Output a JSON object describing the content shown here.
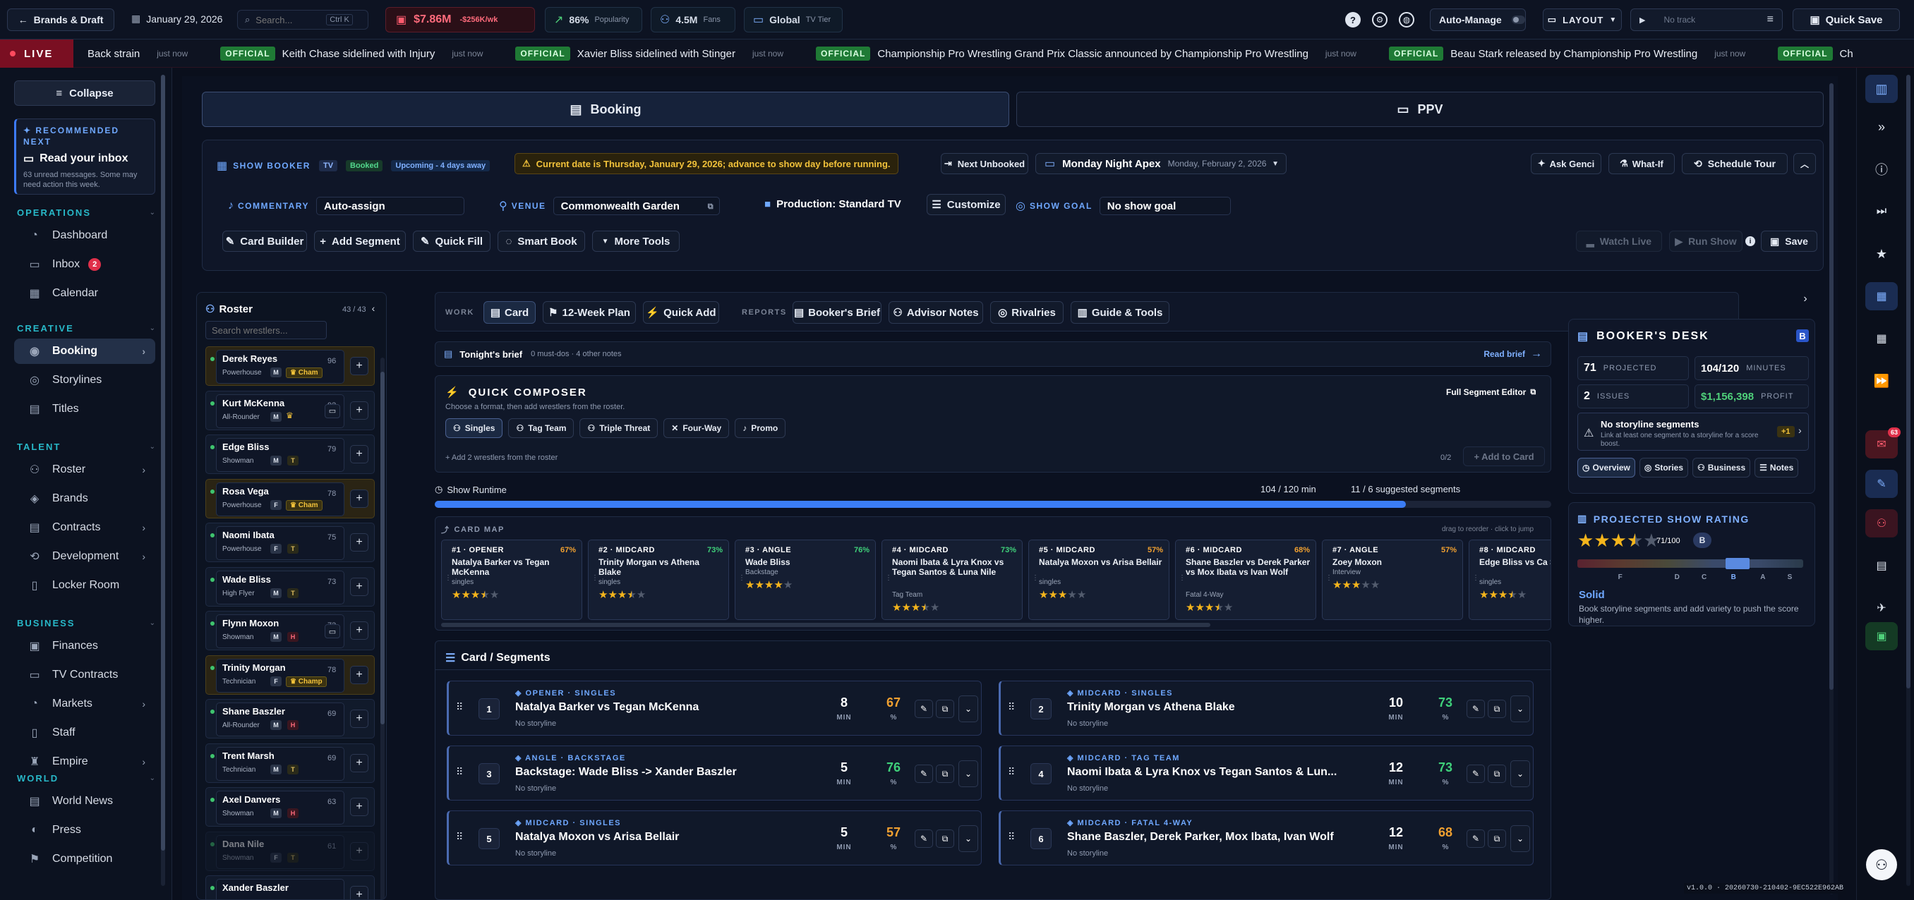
{
  "topbar": {
    "brand_btn": "Brands & Draft",
    "date": "January 29, 2026",
    "search_placeholder": "Search...",
    "search_kbd": "Ctrl K",
    "money": "$7.86M",
    "money_delta": "-$256K/wk",
    "popularity": "86%",
    "popularity_label": "Popularity",
    "fans": "4.5M",
    "fans_label": "Fans",
    "tier": "Global",
    "tier_label": "TV Tier",
    "automanage": "Auto-Manage",
    "layout": "LAYOUT",
    "track": "No track",
    "quicksave": "Quick Save"
  },
  "ticker": {
    "live": "LIVE",
    "first": "Back strain",
    "first_ago": "just now",
    "items": [
      {
        "tag": "OFFICIAL",
        "text": "Keith Chase sidelined with Injury",
        "ago": "just now"
      },
      {
        "tag": "OFFICIAL",
        "text": "Xavier Bliss sidelined with Stinger",
        "ago": "just now"
      },
      {
        "tag": "OFFICIAL",
        "text": "Championship Pro Wrestling Grand Prix Classic announced by Championship Pro Wrestling",
        "ago": "just now"
      },
      {
        "tag": "OFFICIAL",
        "text": "Beau Stark released by Championship Pro Wrestling",
        "ago": "just now"
      },
      {
        "tag": "OFFICIAL",
        "text": "Ch",
        "ago": ""
      }
    ]
  },
  "nav": {
    "collapse": "Collapse",
    "rec_label": "RECOMMENDED NEXT",
    "rec_title": "Read your inbox",
    "rec_desc": "63 unread messages. Some may need action this week.",
    "sections": [
      {
        "title": "OPERATIONS",
        "items": [
          {
            "label": "Dashboard",
            "icon": "◔"
          },
          {
            "label": "Inbox",
            "icon": "▭",
            "badge": "2"
          },
          {
            "label": "Calendar",
            "icon": "▦"
          }
        ]
      },
      {
        "title": "CREATIVE",
        "items": [
          {
            "label": "Booking",
            "icon": "◉",
            "active": true,
            "chev": true
          },
          {
            "label": "Storylines",
            "icon": "◎"
          },
          {
            "label": "Titles",
            "icon": "▤"
          }
        ]
      },
      {
        "title": "TALENT",
        "items": [
          {
            "label": "Roster",
            "icon": "⚇",
            "chev": true
          },
          {
            "label": "Brands",
            "icon": "◈"
          },
          {
            "label": "Contracts",
            "icon": "▤",
            "chev": true
          },
          {
            "label": "Development",
            "icon": "⟲",
            "chev": true
          },
          {
            "label": "Locker Room",
            "icon": "▯"
          }
        ]
      },
      {
        "title": "BUSINESS",
        "items": [
          {
            "label": "Finances",
            "icon": "▣"
          },
          {
            "label": "TV Contracts",
            "icon": "▭"
          },
          {
            "label": "Markets",
            "icon": "◔",
            "chev": true
          },
          {
            "label": "Staff",
            "icon": "▯"
          },
          {
            "label": "Empire",
            "icon": "♜",
            "chev": true
          }
        ]
      },
      {
        "title": "WORLD",
        "items": [
          {
            "label": "World News",
            "icon": "▤"
          },
          {
            "label": "Press",
            "icon": "◐"
          },
          {
            "label": "Competition",
            "icon": "⚑"
          }
        ]
      }
    ]
  },
  "tabs": {
    "booking": "Booking",
    "ppv": "PPV"
  },
  "header": {
    "show_booker": "SHOW BOOKER",
    "tv": "TV",
    "booked": "Booked",
    "upcoming": "Upcoming - 4 days away",
    "warning": "Current date is Thursday, January 29, 2026; advance to show day before running.",
    "next_unbooked": "Next Unbooked",
    "show_name": "Monday Night Apex",
    "show_date": "Monday, February 2, 2026",
    "ask": "Ask Genci",
    "whatif": "What-If",
    "tour": "Schedule Tour",
    "commentary_label": "COMMENTARY",
    "commentary": "Auto-assign",
    "venue_label": "VENUE",
    "venue": "Commonwealth Garden",
    "production": "Production: Standard TV",
    "customize": "Customize",
    "goal_label": "SHOW GOAL",
    "goal": "No show goal",
    "card_builder": "Card Builder",
    "add_segment": "Add Segment",
    "quick_fill": "Quick Fill",
    "smart_book": "Smart Book",
    "more_tools": "More Tools",
    "watch_live": "Watch Live",
    "run_show": "Run Show",
    "save": "Save"
  },
  "roster": {
    "title": "Roster",
    "count": "43 / 43",
    "search_placeholder": "Search wrestlers...",
    "rows": [
      {
        "name": "Derek Reyes",
        "role": "Powerhouse",
        "g": "M",
        "ovr": "96",
        "champ": "Cham",
        "hl": true
      },
      {
        "name": "Kurt McKenna",
        "role": "All-Rounder",
        "g": "M",
        "ovr": "92",
        "crown": true
      },
      {
        "name": "Edge Bliss",
        "role": "Showman",
        "g": "M",
        "ovr": "79",
        "st": "T"
      },
      {
        "name": "Rosa Vega",
        "role": "Powerhouse",
        "g": "F",
        "ovr": "78",
        "champ": "Cham",
        "hl": true
      },
      {
        "name": "Naomi Ibata",
        "role": "Powerhouse",
        "g": "F",
        "ovr": "75",
        "st": "T"
      },
      {
        "name": "Wade Bliss",
        "role": "High Flyer",
        "g": "M",
        "ovr": "73",
        "st": "T"
      },
      {
        "name": "Flynn Moxon",
        "role": "Showman",
        "g": "M",
        "ovr": "73",
        "st": "H"
      },
      {
        "name": "Trinity Morgan",
        "role": "Technician",
        "g": "F",
        "ovr": "78",
        "champ": "Champ",
        "hl": true
      },
      {
        "name": "Shane Baszler",
        "role": "All-Rounder",
        "g": "M",
        "ovr": "69",
        "st": "H"
      },
      {
        "name": "Trent Marsh",
        "role": "Technician",
        "g": "M",
        "ovr": "69",
        "st": "T"
      },
      {
        "name": "Axel Danvers",
        "role": "Showman",
        "g": "M",
        "ovr": "63",
        "st": "H"
      },
      {
        "name": "Dana Nile",
        "role": "Showman",
        "g": "F",
        "ovr": "61",
        "st": "T",
        "dim": true
      },
      {
        "name": "Xander Baszler",
        "role": "",
        "g": "",
        "ovr": "",
        "st": ""
      }
    ]
  },
  "worktabs": {
    "work": "WORK",
    "card": "Card",
    "plan": "12-Week Plan",
    "quickadd": "Quick Add",
    "reports": "REPORTS",
    "brief": "Booker's Brief",
    "advisor": "Advisor Notes",
    "rivalries": "Rivalries",
    "guide": "Guide & Tools"
  },
  "brief": {
    "title": "Tonight's brief",
    "sub": "0 must-dos · 4 other notes",
    "read": "Read brief"
  },
  "composer": {
    "title": "QUICK COMPOSER",
    "sub": "Choose a format, then add wrestlers from the roster.",
    "editor": "Full Segment Editor",
    "formats": [
      "Singles",
      "Tag Team",
      "Triple Threat",
      "Four-Way",
      "Promo"
    ],
    "hint": "+ Add 2 wrestlers from the roster",
    "count": "0/2",
    "add": "+ Add to Card"
  },
  "runtime": {
    "label": "Show Runtime",
    "value": "104 / 120 min",
    "suggest": "11 / 6 suggested segments",
    "progress": 0.87
  },
  "cardmap": {
    "title": "CARD MAP",
    "hint": "drag to reorder · click to jump",
    "items": [
      {
        "slot": "#1 · OPENER",
        "pct": "67%",
        "names": "Natalya Barker vs Tegan McKenna",
        "type": "singles",
        "stars": 3.5
      },
      {
        "slot": "#2 · MIDCARD",
        "pct": "73%",
        "names": "Trinity Morgan vs Athena Blake",
        "type": "singles",
        "stars": 3.5
      },
      {
        "slot": "#3 · ANGLE",
        "pct": "76%",
        "names": "Wade Bliss",
        "type": "Backstage",
        "stars": 4
      },
      {
        "slot": "#4 · MIDCARD",
        "pct": "73%",
        "names": "Naomi Ibata & Lyra Knox vs Tegan Santos & Luna Nile",
        "type": "Tag Team",
        "stars": 3.5
      },
      {
        "slot": "#5 · MIDCARD",
        "pct": "57%",
        "names": "Natalya Moxon vs Arisa Bellair",
        "type": "singles",
        "stars": 3
      },
      {
        "slot": "#6 · MIDCARD",
        "pct": "68%",
        "names": "Shane Baszler vs Derek Parker vs Mox Ibata vs Ivan Wolf",
        "type": "Fatal 4-Way",
        "stars": 3.5
      },
      {
        "slot": "#7 · ANGLE",
        "pct": "57%",
        "names": "Zoey Moxon",
        "type": "Interview",
        "stars": 3
      },
      {
        "slot": "#8 · MIDCARD",
        "pct": "",
        "names": "Edge Bliss vs Ca Strickland",
        "type": "singles",
        "stars": 3.5
      }
    ]
  },
  "segments": {
    "title": "Card / Segments",
    "min": "MIN",
    "pct": "%",
    "nostory": "No storyline",
    "items": [
      {
        "n": "1",
        "kind": "OPENER · SINGLES",
        "title": "Natalya Barker vs Tegan McKenna",
        "min": "8",
        "pct": "67",
        "col": "#f0a030"
      },
      {
        "n": "2",
        "kind": "MIDCARD · SINGLES",
        "title": "Trinity Morgan vs Athena Blake",
        "min": "10",
        "pct": "73",
        "col": "#3fd07a"
      },
      {
        "n": "3",
        "kind": "ANGLE · BACKSTAGE",
        "title": "Backstage: Wade Bliss -> Xander Baszler",
        "min": "5",
        "pct": "76",
        "col": "#3fd07a"
      },
      {
        "n": "4",
        "kind": "MIDCARD · TAG TEAM",
        "title": "Naomi Ibata & Lyra Knox vs Tegan Santos & Lun...",
        "min": "12",
        "pct": "73",
        "col": "#3fd07a"
      },
      {
        "n": "5",
        "kind": "MIDCARD · SINGLES",
        "title": "Natalya Moxon vs Arisa Bellair",
        "min": "5",
        "pct": "57",
        "col": "#f0a030"
      },
      {
        "n": "6",
        "kind": "MIDCARD · FATAL 4-WAY",
        "title": "Shane Baszler, Derek Parker, Mox Ibata, Ivan Wolf",
        "min": "12",
        "pct": "68",
        "col": "#f0a030"
      }
    ]
  },
  "desk": {
    "title": "BOOKER'S DESK",
    "grade": "B",
    "projected": "71",
    "projected_l": "PROJECTED",
    "minutes": "104/120",
    "minutes_l": "MINUTES",
    "issues": "2",
    "issues_l": "ISSUES",
    "profit": "$1,156,398",
    "profit_l": "PROFIT",
    "warn_title": "No storyline segments",
    "warn_desc": "Link at least one segment to a storyline for a score boost.",
    "warn_badge": "+1",
    "tabs": [
      "Overview",
      "Stories",
      "Business",
      "Notes"
    ]
  },
  "rating": {
    "title": "PROJECTED SHOW RATING",
    "score": "71/100",
    "grade": "B",
    "stars": 3.5,
    "letters": [
      "F",
      "D",
      "C",
      "B",
      "A",
      "S"
    ],
    "verdict": "Solid",
    "desc": "Book storyline segments and add variety to push the score higher.",
    "marker": 0.71
  },
  "version": "v1.0.0 · 20260730-210402-9EC522E962AB",
  "rightbar_badge": "63"
}
